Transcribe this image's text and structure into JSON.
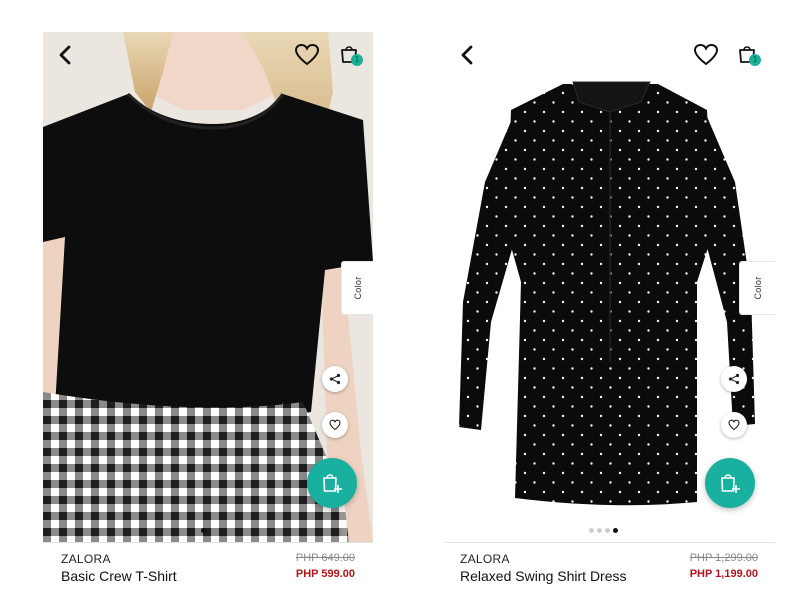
{
  "screens": [
    {
      "brand": "ZALORA",
      "product_name": "Basic Crew T-Shirt",
      "old_price": "PHP 649.00",
      "new_price": "PHP 599.00",
      "color_tab": "Color",
      "bag_count": "1",
      "gallery_dots": 1,
      "gallery_active_dot": 0
    },
    {
      "brand": "ZALORA",
      "product_name": "Relaxed Swing Shirt Dress",
      "old_price": "PHP 1,299.00",
      "new_price": "PHP 1,199.00",
      "color_tab": "Color",
      "bag_count": "1",
      "gallery_dots": 4,
      "gallery_active_dot": 3
    }
  ],
  "icons": {
    "back": "chevron-left-icon",
    "wishlist": "heart-icon",
    "bag": "shopping-bag-icon",
    "share": "share-icon",
    "favorite": "heart-outline-icon",
    "add_to_cart": "add-to-bag-icon"
  },
  "colors": {
    "accent": "#1ab0a0",
    "sale_price": "#b2151b",
    "old_price": "#888888",
    "text": "#111111"
  }
}
